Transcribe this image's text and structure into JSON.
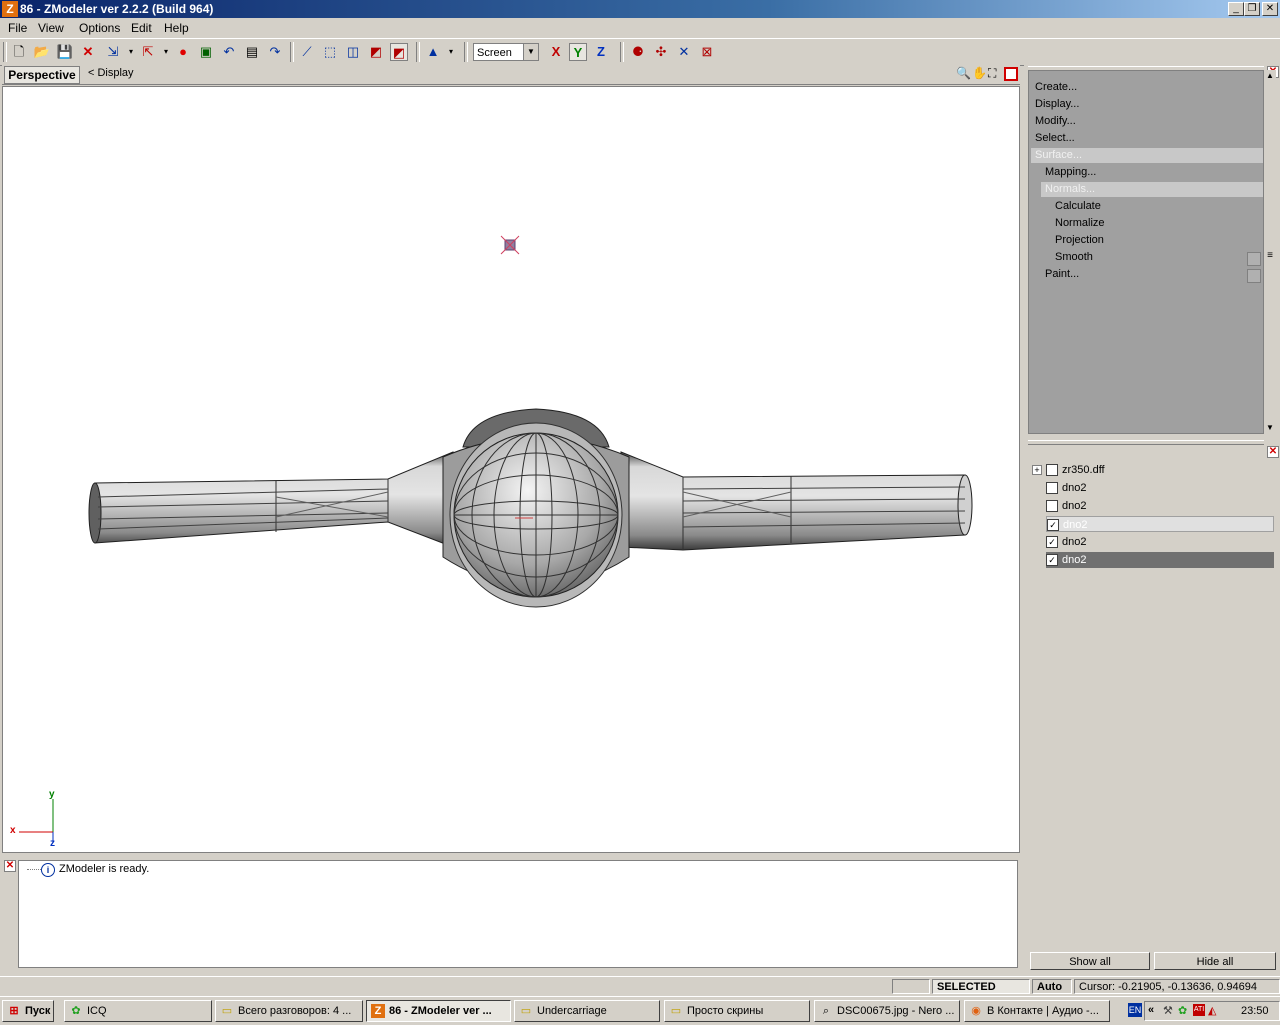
{
  "window": {
    "app_icon": "Z",
    "title": "86 - ZModeler ver 2.2.2 (Build 964)",
    "controls": [
      "minimize",
      "maximize",
      "close"
    ]
  },
  "menu": [
    "File",
    "View",
    "Options",
    "Edit",
    "Help"
  ],
  "toolbar": {
    "screen_select": "Screen",
    "axes": [
      "X",
      "Y",
      "Z"
    ]
  },
  "viewport": {
    "tab": "Perspective",
    "crumb": "< Display",
    "axis_labels": {
      "x": "x",
      "y": "y",
      "z": "z"
    }
  },
  "log": {
    "message": "ZModeler is ready."
  },
  "commands": {
    "items": [
      {
        "label": "Create...",
        "selected": false
      },
      {
        "label": "Display...",
        "selected": false
      },
      {
        "label": "Modify...",
        "selected": false
      },
      {
        "label": "Select...",
        "selected": false
      },
      {
        "label": "Surface...",
        "selected": true
      },
      {
        "label": "Mapping...",
        "selected": false
      },
      {
        "label": "Normals...",
        "selected": true
      },
      {
        "label": "Calculate",
        "selected": false
      },
      {
        "label": "Normalize",
        "selected": false
      },
      {
        "label": "Projection",
        "selected": false
      },
      {
        "label": "Smooth",
        "selected": false
      },
      {
        "label": "Paint...",
        "selected": false
      }
    ]
  },
  "objects": {
    "items": [
      {
        "name": "zr350.dff",
        "checked": false,
        "expander": "+"
      },
      {
        "name": "dno2",
        "checked": false
      },
      {
        "name": "dno2",
        "checked": false
      },
      {
        "name": "dno2",
        "checked": true,
        "state": "highlighted"
      },
      {
        "name": "dno2",
        "checked": true
      },
      {
        "name": "dno2",
        "checked": true,
        "state": "selected"
      }
    ],
    "show_all": "Show all",
    "hide_all": "Hide all"
  },
  "status": {
    "mode": "SELECTED MODE",
    "auto": "Auto",
    "cursor": "Cursor: -0.21905, -0.13636, 0.94694"
  },
  "taskbar": {
    "start": "Пуск",
    "tasks": [
      {
        "label": "ICQ",
        "icon": "flower-icon"
      },
      {
        "label": "Всего разговоров: 4 ...",
        "icon": "folder-icon"
      },
      {
        "label": "86 - ZModeler ver ...",
        "icon": "zmodeler-icon",
        "active": true
      },
      {
        "label": "Undercarriage",
        "icon": "folder-icon"
      },
      {
        "label": "Просто скрины",
        "icon": "folder-icon"
      },
      {
        "label": "DSC00675.jpg - Nero ...",
        "icon": "search-icon"
      },
      {
        "label": "В Контакте | Аудио -...",
        "icon": "firefox-icon"
      }
    ],
    "lang": "EN",
    "clock": "23:50"
  }
}
